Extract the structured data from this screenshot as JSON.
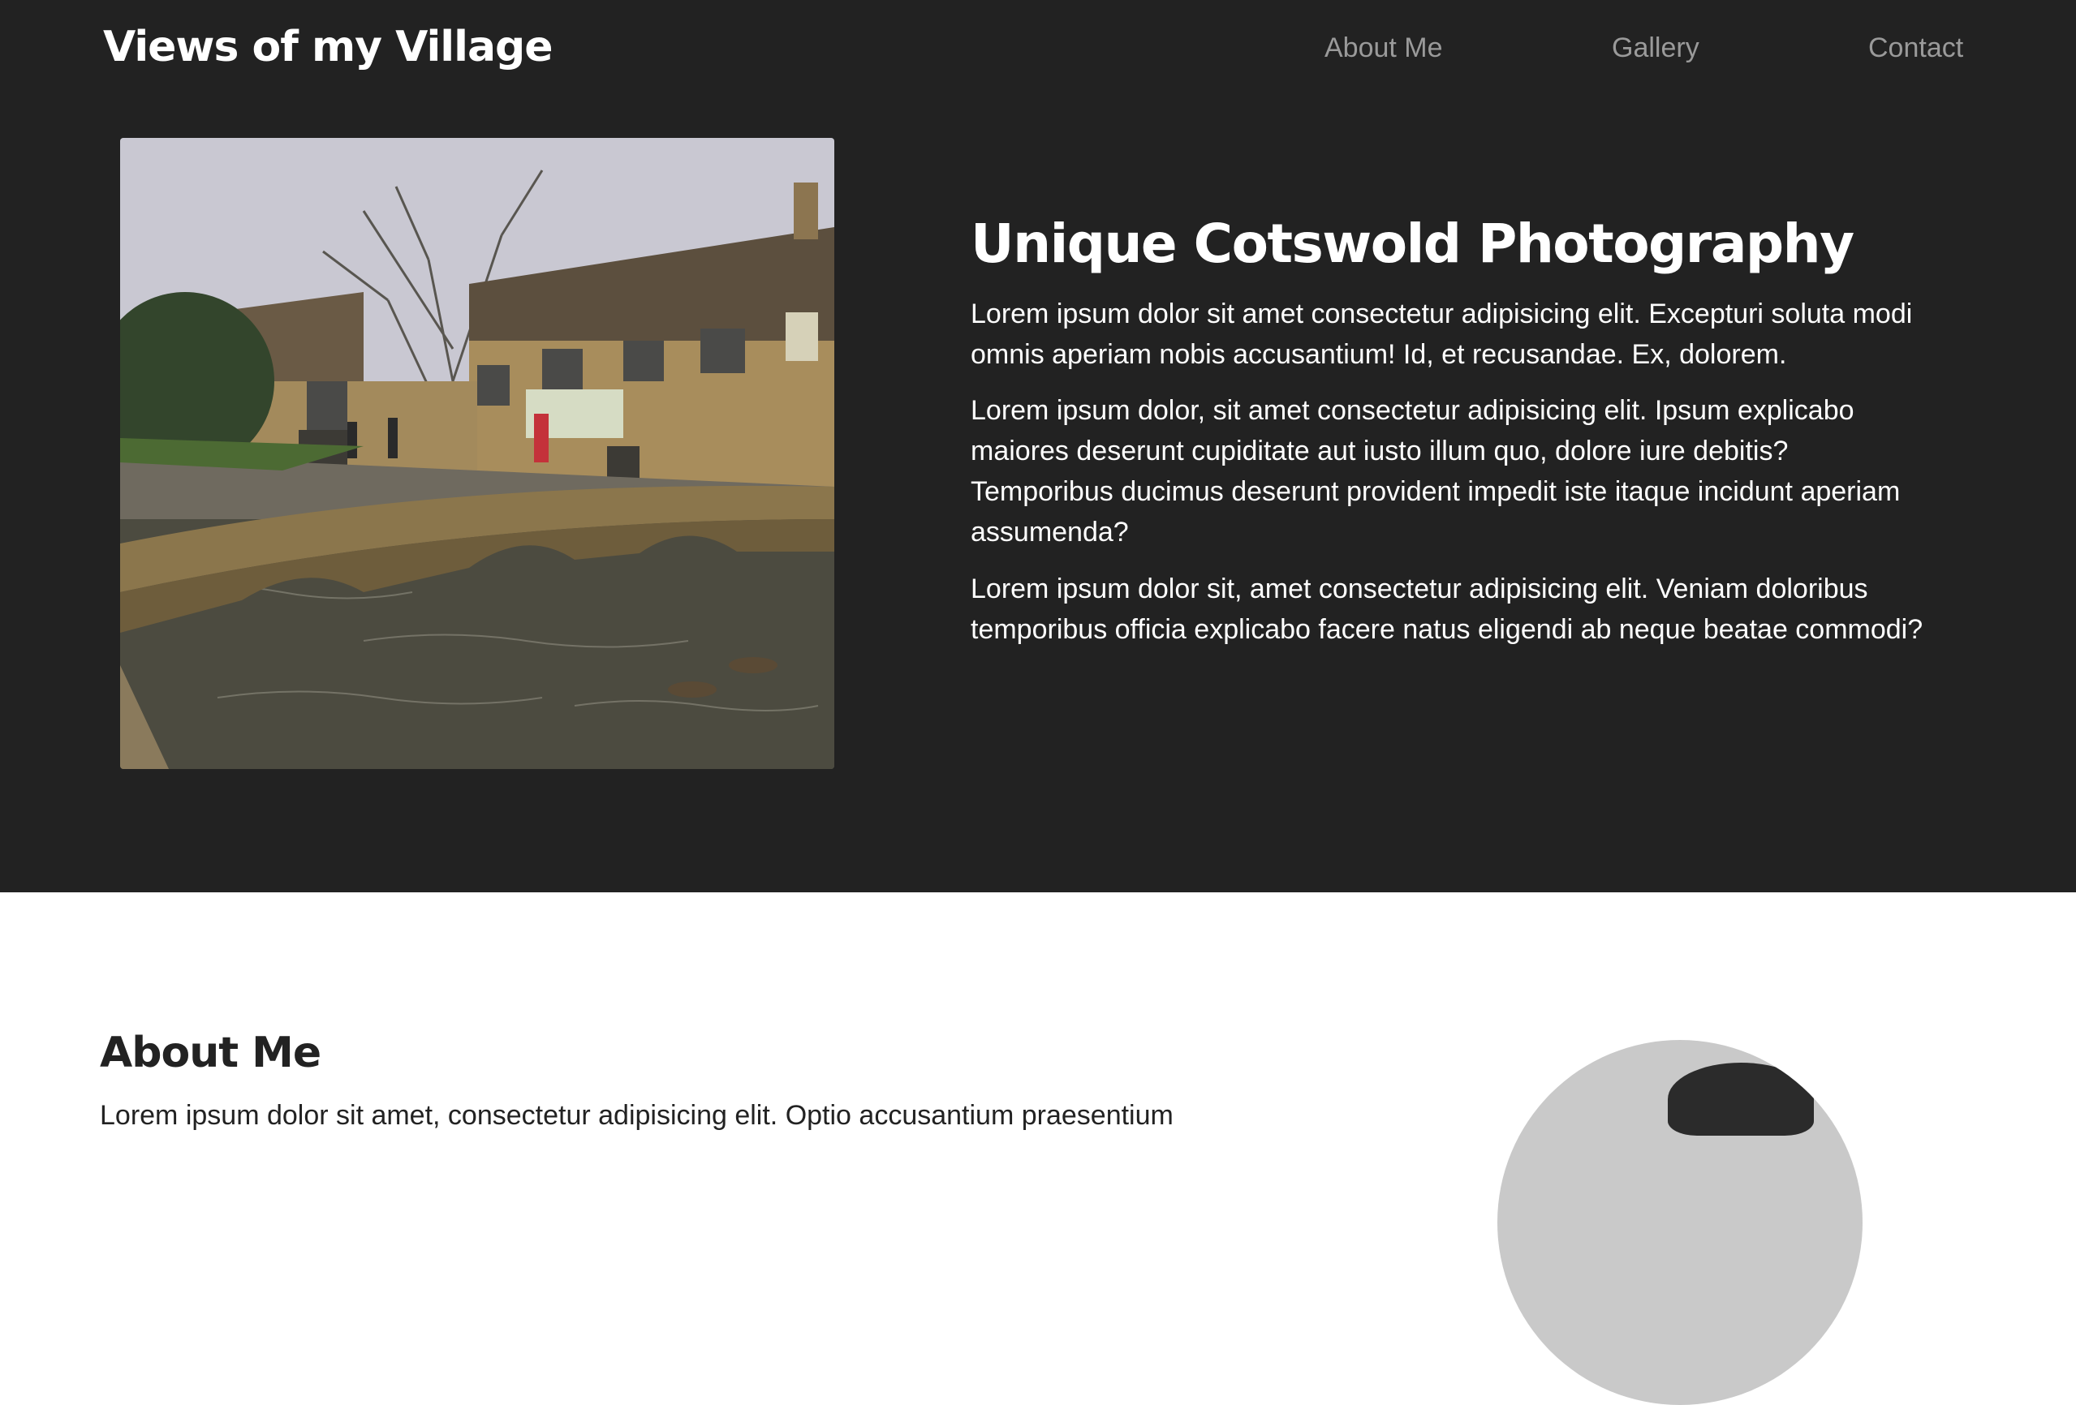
{
  "header": {
    "brand": "Views of my Village",
    "nav": [
      {
        "label": "About Me"
      },
      {
        "label": "Gallery"
      },
      {
        "label": "Contact"
      }
    ]
  },
  "hero": {
    "title": "Unique Cotswold Photography",
    "paragraphs": [
      "Lorem ipsum dolor sit amet consectetur adipisicing elit. Excepturi soluta modi omnis aperiam nobis accusantium! Id, et recusandae. Ex, dolorem.",
      "Lorem ipsum dolor, sit amet consectetur adipisicing elit. Ipsum explicabo maiores deserunt cupiditate aut iusto illum quo, dolore iure debitis? Temporibus ducimus deserunt provident impedit iste itaque incidunt aperiam assumenda?",
      "Lorem ipsum dolor sit, amet consectetur adipisicing elit. Veniam doloribus temporibus officia explicabo facere natus eligendi ab neque beatae commodi?"
    ]
  },
  "about": {
    "title": "About Me",
    "text": "Lorem ipsum dolor sit amet, consectetur adipisicing elit. Optio accusantium praesentium"
  },
  "colors": {
    "hero_background": "#222222",
    "nav_link": "#9a9a9a",
    "page_background": "#ffffff"
  }
}
